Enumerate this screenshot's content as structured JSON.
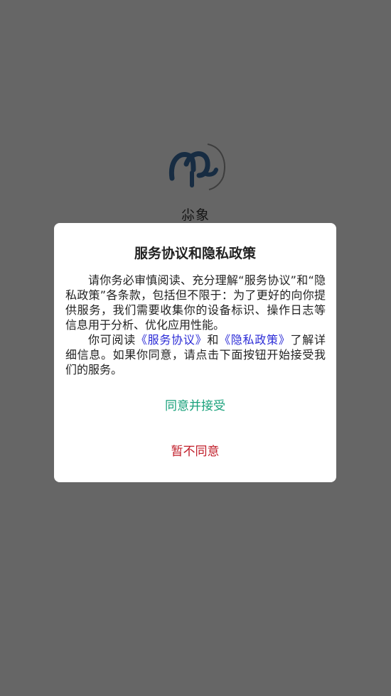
{
  "app": {
    "name": "尛象"
  },
  "dialog": {
    "title": "服务协议和隐私政策",
    "paragraph1": "请你务必审慎阅读、充分理解“服务协议”和“隐私政策”各条款，包括但不限于：为了更好的向你提供服务，我们需要收集你的设备标识、操作日志等信息用于分析、优化应用性能。",
    "paragraph2_prefix": "你可阅读",
    "service_link": "《服务协议》",
    "and_text": "和",
    "privacy_link": "《隐私政策》",
    "paragraph2_suffix": "了解详细信息。如果你同意，请点击下面按钮开始接受我们的服务。",
    "agree_label": "同意并接受",
    "disagree_label": "暂不同意"
  },
  "colors": {
    "logo_blue": "#3a6ea5",
    "agree": "#17a07a",
    "disagree": "#c01c28",
    "link": "#2b2bd6"
  }
}
